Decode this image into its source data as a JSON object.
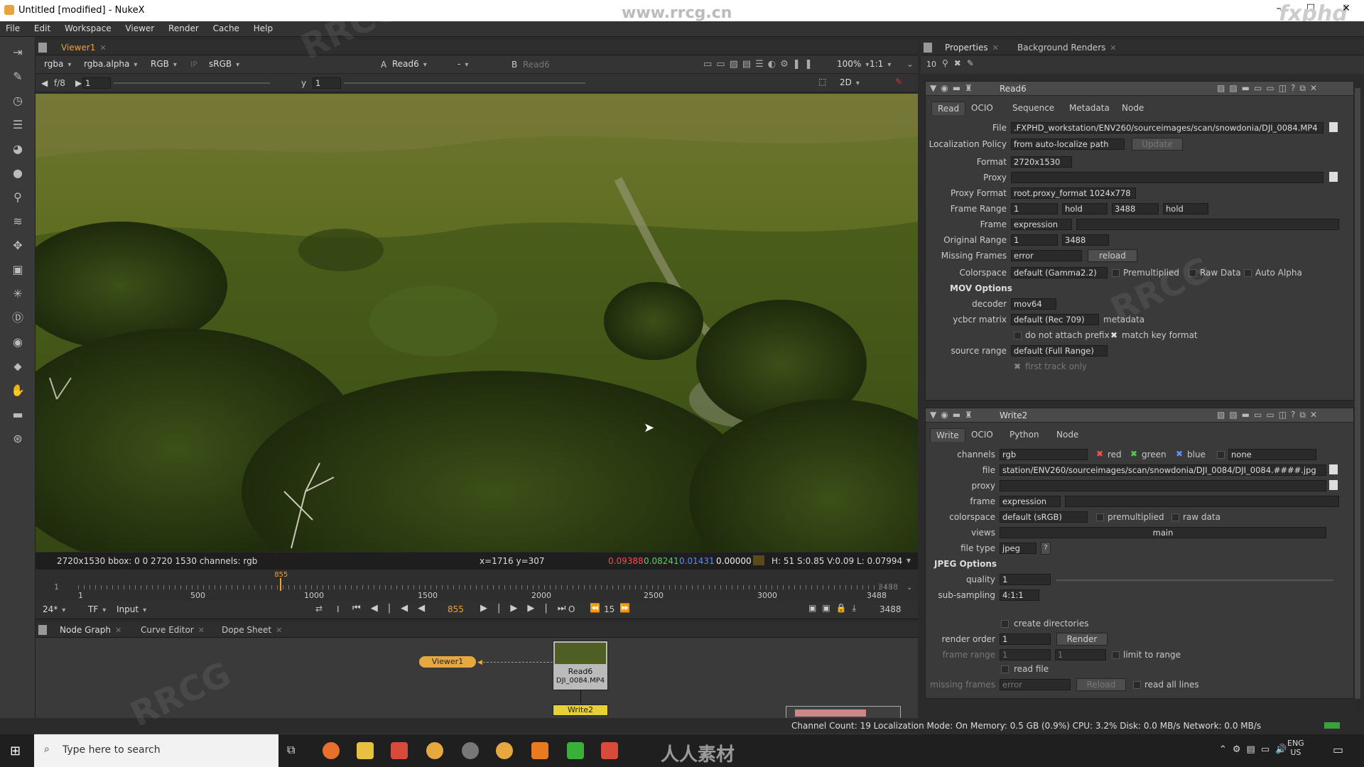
{
  "window": {
    "title": "Untitled [modified] - NukeX",
    "watermark_url": "www.rrcg.cn",
    "brand": "fxphd"
  },
  "menu": [
    "File",
    "Edit",
    "Workspace",
    "Viewer",
    "Render",
    "Cache",
    "Help"
  ],
  "viewer": {
    "tab": "Viewer1",
    "channel": "rgba",
    "alpha": "rgba.alpha",
    "display": "RGB",
    "ip": "IP",
    "lut": "sRGB",
    "a_label": "A",
    "a_input": "Read6",
    "b_dash": "-",
    "b_label": "B",
    "b_input": "Read6",
    "zoom": "100%",
    "ratio": "1:1",
    "fstop": "f/8",
    "gain": "1",
    "y_label": "y",
    "gamma": "1",
    "mode2d": "2D",
    "info_left": "2720x1530  bbox: 0 0 2720 1530 channels: rgb",
    "info_xy": "x=1716 y=307",
    "info_r": "0.09388",
    "info_g": "0.08241",
    "info_b": "0.01431",
    "info_a": "0.00000",
    "info_hsv": "H: 51 S:0.85 V:0.09  L: 0.07994"
  },
  "timeline": {
    "start": "1",
    "end": "3488",
    "current": "855",
    "ticks": [
      "1",
      "500",
      "1000",
      "1500",
      "2000",
      "2500",
      "3000",
      "3488"
    ],
    "fps": "24*",
    "tf": "TF",
    "input": "Input",
    "frame_display": "855",
    "step": "15",
    "end_display": "3488",
    "i_label": "I",
    "o_label": "O",
    "progress": 0.245
  },
  "nodegraph": {
    "tabs": [
      "Node Graph",
      "Curve Editor",
      "Dope Sheet"
    ],
    "viewer_node": "Viewer1",
    "read_node": "Read6",
    "read_sub": "DJI_0084.MP4",
    "write_node": "Write2"
  },
  "status": {
    "text": "Channel Count: 19 Localization Mode: On Memory: 0.5 GB (0.9%) CPU: 3.2% Disk: 0.0 MB/s Network: 0.0 MB/s"
  },
  "properties": {
    "tabs": [
      "Properties",
      "Background Renders"
    ],
    "max_panels": "10",
    "read": {
      "name": "Read6",
      "subtabs": [
        "Read",
        "OCIO",
        "Sequence",
        "Metadata",
        "Node"
      ],
      "file_label": "File",
      "file": ".FXPHD_workstation/ENV260/sourceimages/scan/snowdonia/DJI_0084.MP4",
      "localization_label": "Localization Policy",
      "localization": "from auto-localize path",
      "update": "Update",
      "format_label": "Format",
      "format": "2720x1530",
      "proxy_label": "Proxy",
      "proxy_format_label": "Proxy Format",
      "proxy_format": "root.proxy_format 1024x778",
      "frame_range_label": "Frame Range",
      "fr_start": "1",
      "fr_start_mode": "hold",
      "fr_end": "3488",
      "fr_end_mode": "hold",
      "frame_label": "Frame",
      "frame_mode": "expression",
      "orig_range_label": "Original Range",
      "orig_start": "1",
      "orig_end": "3488",
      "missing_label": "Missing Frames",
      "missing": "error",
      "reload": "reload",
      "colorspace_label": "Colorspace",
      "colorspace": "default (Gamma2.2)",
      "premult": "Premultiplied",
      "raw": "Raw Data",
      "auto_alpha": "Auto Alpha",
      "mov_title": "MOV Options",
      "decoder_label": "decoder",
      "decoder": "mov64",
      "ycbcr_label": "ycbcr matrix",
      "ycbcr": "default (Rec 709)",
      "metadata": "metadata",
      "no_prefix": "do not attach prefix",
      "match_key": "match key format",
      "source_range_label": "source range",
      "source_range": "default (Full Range)",
      "first_track": "first track only"
    },
    "write": {
      "name": "Write2",
      "subtabs": [
        "Write",
        "OCIO",
        "Python",
        "Node"
      ],
      "channels_label": "channels",
      "channels": "rgb",
      "red": "red",
      "green": "green",
      "blue": "blue",
      "alpha": "none",
      "file_label": "file",
      "file": "station/ENV260/sourceimages/scan/snowdonia/DJI_0084/DJI_0084.####.jpg",
      "proxy_label": "proxy",
      "frame_label": "frame",
      "frame": "expression",
      "colorspace_label": "colorspace",
      "colorspace": "default (sRGB)",
      "premult": "premultiplied",
      "raw": "raw data",
      "views_label": "views",
      "views": "main",
      "filetype_label": "file type",
      "filetype": "jpeg",
      "q": "?",
      "jpeg_title": "JPEG Options",
      "quality_label": "quality",
      "quality": "1",
      "subsampling_label": "sub-sampling",
      "subsampling": "4:1:1",
      "create_dirs": "create directories",
      "render_order_label": "render order",
      "render_order": "1",
      "render": "Render",
      "frame_range_label": "frame range",
      "fr_a": "1",
      "fr_b": "1",
      "limit": "limit to range",
      "read_file": "read file",
      "missing_label": "missing frames",
      "missing": "error",
      "reload": "Reload",
      "all_lines": "read all lines"
    }
  },
  "taskbar": {
    "search": "Type here to search",
    "lang": "ENG",
    "region": "US"
  },
  "overlay": {
    "logo_text": "人人素材"
  }
}
